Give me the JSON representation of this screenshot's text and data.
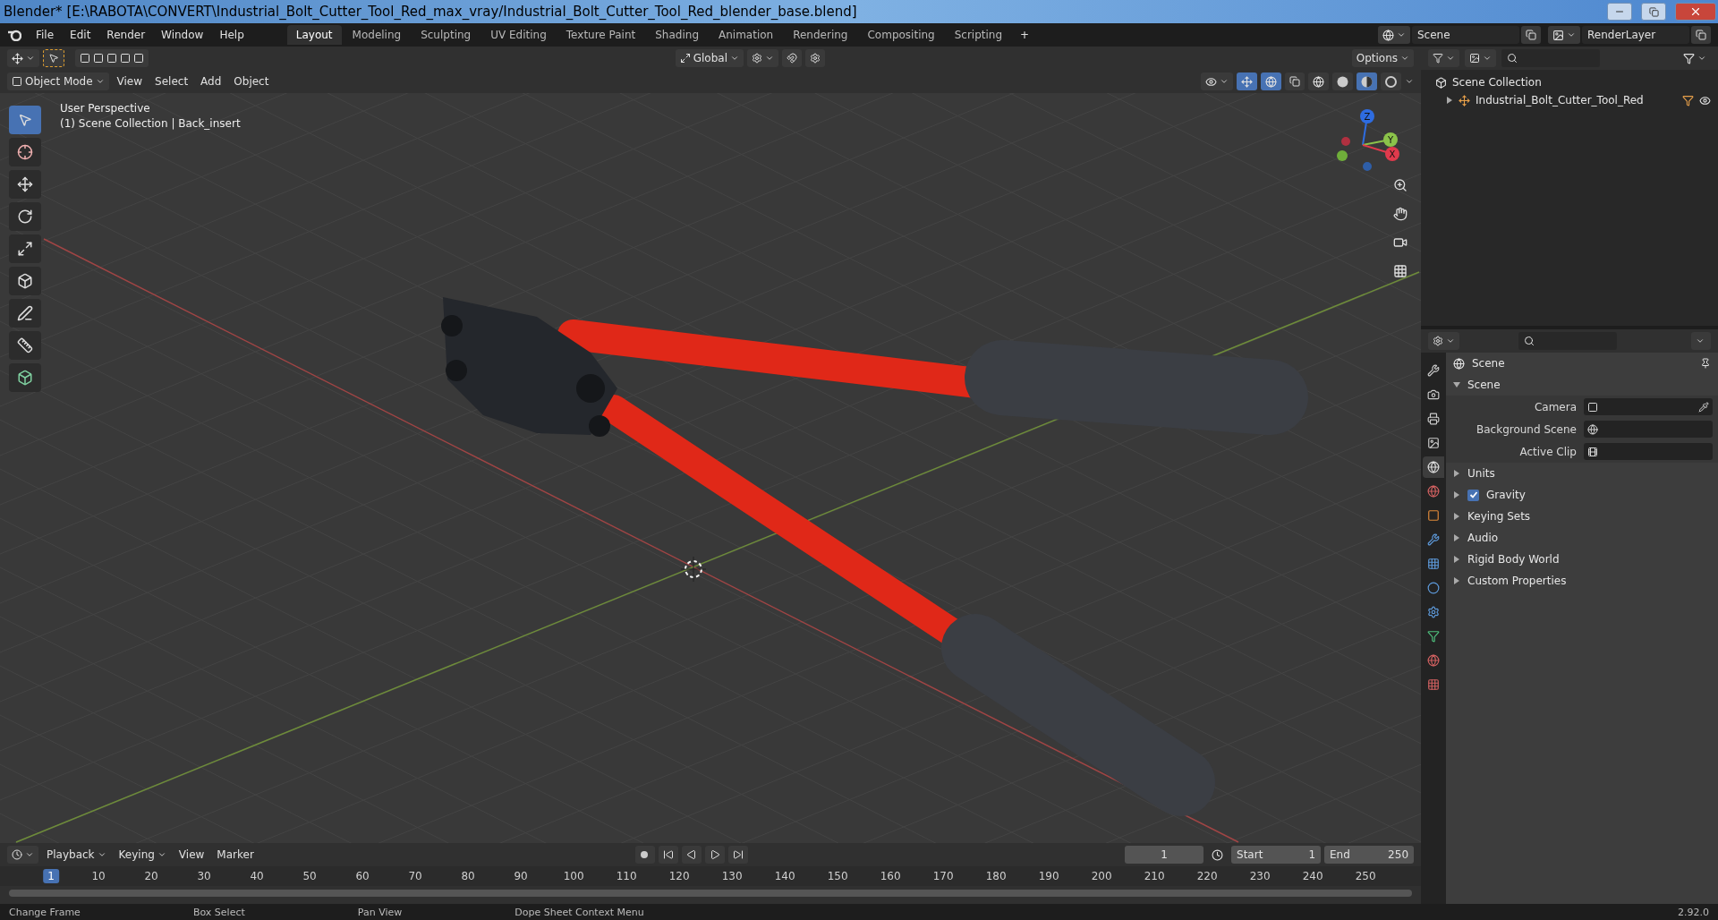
{
  "window": {
    "title": "Blender* [E:\\RABOTA\\CONVERT\\Industrial_Bolt_Cutter_Tool_Red_max_vray/Industrial_Bolt_Cutter_Tool_Red_blender_base.blend]"
  },
  "menus": [
    "File",
    "Edit",
    "Render",
    "Window",
    "Help"
  ],
  "workspaces": [
    {
      "label": "Layout",
      "selected": true
    },
    {
      "label": "Modeling",
      "selected": false
    },
    {
      "label": "Sculpting",
      "selected": false
    },
    {
      "label": "UV Editing",
      "selected": false
    },
    {
      "label": "Texture Paint",
      "selected": false
    },
    {
      "label": "Shading",
      "selected": false
    },
    {
      "label": "Animation",
      "selected": false
    },
    {
      "label": "Rendering",
      "selected": false
    },
    {
      "label": "Compositing",
      "selected": false
    },
    {
      "label": "Scripting",
      "selected": false
    }
  ],
  "add_workspace": "+",
  "scene_field": "Scene",
  "view_layer_field": "RenderLayer",
  "tool_header": {
    "orientation": "Global",
    "options": "Options"
  },
  "viewport_header": {
    "mode": "Object Mode",
    "menus": [
      "View",
      "Select",
      "Add",
      "Object"
    ],
    "shading": [
      {
        "kind": "wireframe",
        "selected": false
      },
      {
        "kind": "solid",
        "selected": false
      },
      {
        "kind": "material",
        "selected": true
      },
      {
        "kind": "rendered",
        "selected": false
      }
    ]
  },
  "viewport": {
    "perspective": "User Perspective",
    "context": "(1) Scene Collection | Back_insert",
    "gizmo_axes": [
      "Z",
      "Y",
      "X"
    ]
  },
  "tools": [
    {
      "kind": "select",
      "selected": true
    },
    {
      "kind": "cursor",
      "selected": false
    },
    {
      "kind": "move",
      "selected": false
    },
    {
      "kind": "rotate",
      "selected": false
    },
    {
      "kind": "scale",
      "selected": false
    },
    {
      "kind": "transform",
      "selected": false
    },
    {
      "kind": "annotate",
      "selected": false
    },
    {
      "kind": "measure",
      "selected": false
    },
    {
      "kind": "add",
      "selected": false
    }
  ],
  "outliner": {
    "root": "Scene Collection",
    "items": [
      {
        "label": "Industrial_Bolt_Cutter_Tool_Red",
        "expanded": false
      }
    ]
  },
  "properties": {
    "header": "Scene",
    "tabs": [
      {
        "kind": "tool",
        "selected": false
      },
      {
        "kind": "render",
        "selected": false
      },
      {
        "kind": "output",
        "selected": false
      },
      {
        "kind": "view_layer",
        "selected": false
      },
      {
        "kind": "scene",
        "selected": true
      },
      {
        "kind": "world",
        "selected": false
      },
      {
        "kind": "object",
        "selected": false
      },
      {
        "kind": "modifier",
        "selected": false
      },
      {
        "kind": "particles",
        "selected": false
      },
      {
        "kind": "physics",
        "selected": false
      },
      {
        "kind": "constraints",
        "selected": false
      },
      {
        "kind": "data",
        "selected": false
      },
      {
        "kind": "material",
        "selected": false
      },
      {
        "kind": "texture",
        "selected": false
      }
    ],
    "panel": {
      "title": "Scene",
      "expanded": true,
      "fields": [
        {
          "label": "Camera",
          "kind": "camera"
        },
        {
          "label": "Background Scene",
          "kind": "scene"
        },
        {
          "label": "Active Clip",
          "kind": "clip"
        }
      ]
    },
    "subpanels": [
      {
        "label": "Units",
        "kind": "plain"
      },
      {
        "label": "Gravity",
        "kind": "checkbox",
        "checked": true
      },
      {
        "label": "Keying Sets",
        "kind": "plain"
      },
      {
        "label": "Audio",
        "kind": "plain"
      },
      {
        "label": "Rigid Body World",
        "kind": "plain"
      },
      {
        "label": "Custom Properties",
        "kind": "plain"
      }
    ]
  },
  "timeline": {
    "menus": [
      "Playback",
      "Keying",
      "View",
      "Marker"
    ],
    "current_frame": "1",
    "start_label": "Start",
    "start": "1",
    "end_label": "End",
    "end": "250",
    "ticks": [
      "1",
      "10",
      "20",
      "30",
      "40",
      "50",
      "60",
      "70",
      "80",
      "90",
      "100",
      "110",
      "120",
      "130",
      "140",
      "150",
      "160",
      "170",
      "180",
      "190",
      "200",
      "210",
      "220",
      "230",
      "240",
      "250"
    ]
  },
  "status_bar": {
    "items": [
      "Change Frame",
      "Box Select",
      "Pan View",
      "Dope Sheet Context Menu"
    ],
    "version": "2.92.0"
  }
}
